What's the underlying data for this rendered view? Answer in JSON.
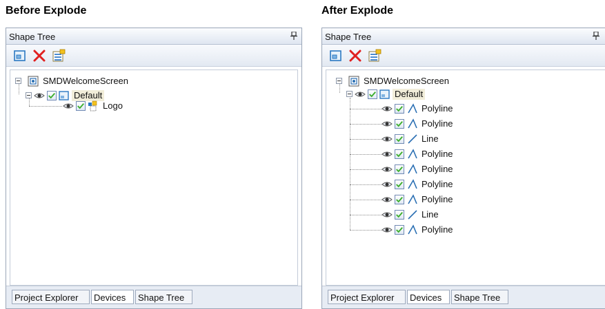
{
  "panels": [
    {
      "heading": "Before Explode",
      "title": "Shape Tree",
      "root": {
        "label": "SMDWelcomeScreen"
      },
      "layer": {
        "label": "Default"
      },
      "children": [
        {
          "label": "Logo",
          "icon": "group-shape-icon"
        }
      ],
      "tabs": [
        {
          "label": "Project Explorer"
        },
        {
          "label": "Devices"
        },
        {
          "label": "Shape Tree"
        }
      ]
    },
    {
      "heading": "After Explode",
      "title": "Shape Tree",
      "root": {
        "label": "SMDWelcomeScreen"
      },
      "layer": {
        "label": "Default"
      },
      "children": [
        {
          "label": "Polyline",
          "icon": "polyline-icon"
        },
        {
          "label": "Polyline",
          "icon": "polyline-icon"
        },
        {
          "label": "Line",
          "icon": "line-icon"
        },
        {
          "label": "Polyline",
          "icon": "polyline-icon"
        },
        {
          "label": "Polyline",
          "icon": "polyline-icon"
        },
        {
          "label": "Polyline",
          "icon": "polyline-icon"
        },
        {
          "label": "Polyline",
          "icon": "polyline-icon"
        },
        {
          "label": "Line",
          "icon": "line-icon"
        },
        {
          "label": "Polyline",
          "icon": "polyline-icon"
        }
      ],
      "tabs": [
        {
          "label": "Project Explorer"
        },
        {
          "label": "Devices"
        },
        {
          "label": "Shape Tree"
        }
      ]
    }
  ],
  "colors": {
    "header_gradient_top": "#fbfcfe",
    "header_gradient_bottom": "#dfe6f1",
    "border": "#9aa6b8",
    "delete_red": "#e02020",
    "check_green": "#3cae2c",
    "selection": "#f1edd9"
  }
}
